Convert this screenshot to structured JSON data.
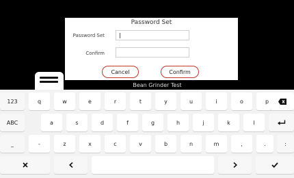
{
  "dialog": {
    "title": "Password Set",
    "password_label": "Password Set",
    "password_value": "",
    "confirm_label": "Confirm",
    "confirm_value": "",
    "cancel_button": "Cancel",
    "confirm_button": "Confirm"
  },
  "status": {
    "text": "Bean Grinder Test"
  },
  "keyboard": {
    "row1": [
      "123",
      "q",
      "w",
      "e",
      "r",
      "t",
      "y",
      "u",
      "i",
      "o",
      "p"
    ],
    "row2": [
      "ABC",
      "a",
      "s",
      "d",
      "f",
      "g",
      "h",
      "j",
      "k",
      "l"
    ],
    "row3": [
      "_",
      "-",
      "z",
      "x",
      "c",
      "v",
      "b",
      "n",
      "m",
      ",",
      ".",
      ":"
    ],
    "backspace_icon": "backspace-icon",
    "enter_icon": "enter-icon",
    "close_icon": "close-icon",
    "left_icon": "chevron-left-icon",
    "right_icon": "chevron-right-icon",
    "done_icon": "checkmark-icon"
  },
  "colors": {
    "accent": "#c0392b",
    "screen_bg": "#000000",
    "keyboard_bg": "#f2f2f2"
  }
}
